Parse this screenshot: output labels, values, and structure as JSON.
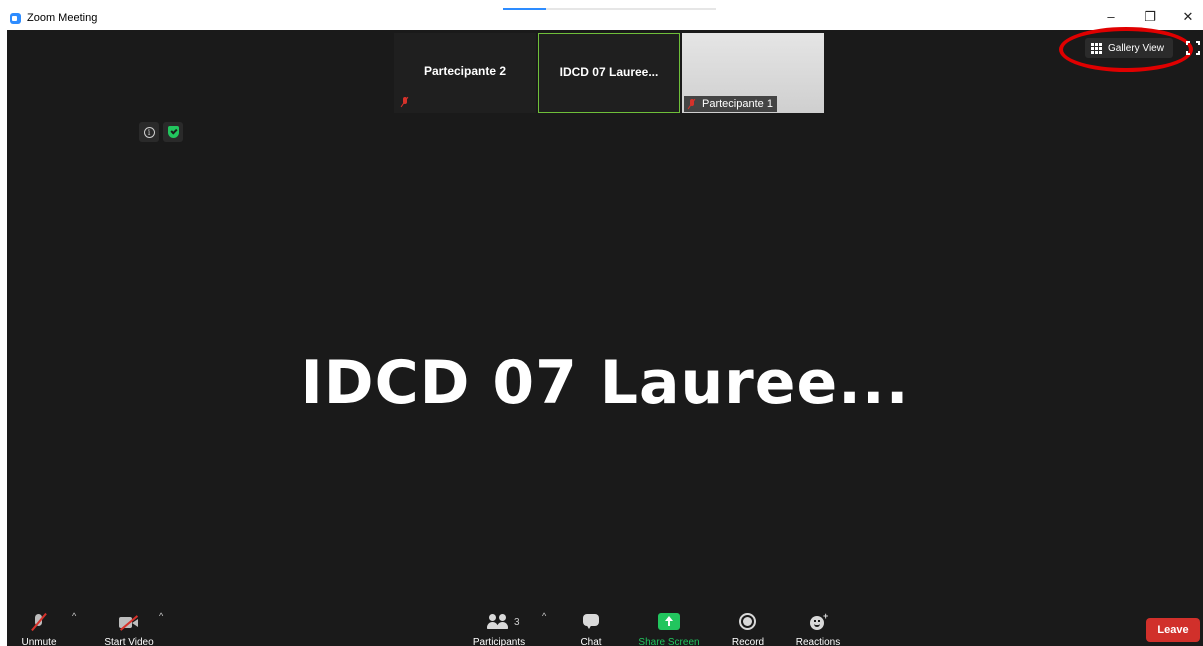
{
  "window": {
    "title": "Zoom Meeting",
    "controls": {
      "minimize": "–",
      "restore": "❐",
      "close": "✕"
    },
    "top_progress": 0.2
  },
  "thumbnails": [
    {
      "name": "Partecipante 2",
      "muted": true
    },
    {
      "name": "IDCD 07 Lauree...",
      "active_speaker": true
    },
    {
      "name": "Partecipante 1",
      "muted": true
    }
  ],
  "view": {
    "gallery_label": "Gallery View"
  },
  "active_speaker": {
    "name": "IDCD 07 Lauree..."
  },
  "badges": {
    "info": "i"
  },
  "toolbar": {
    "unmute": "Unmute",
    "start_video": "Start Video",
    "participants": "Participants",
    "participants_count": "3",
    "chat": "Chat",
    "share_screen": "Share Screen",
    "record": "Record",
    "reactions": "Reactions",
    "leave": "Leave",
    "caret": "^"
  },
  "colors": {
    "background": "#1a1a1a",
    "accent_green": "#22c55e",
    "muted_red": "#d6322b",
    "leave_red": "#d1302b",
    "highlight_red": "#e00000",
    "zoom_blue": "#2d8cff"
  }
}
